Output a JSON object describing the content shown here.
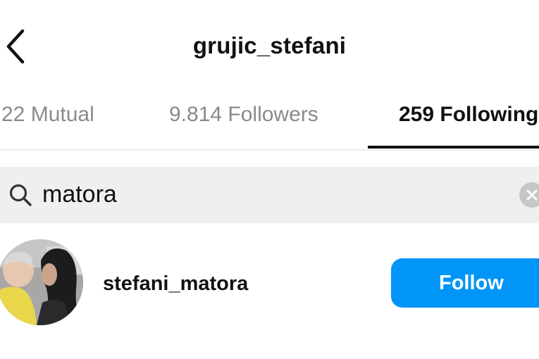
{
  "header": {
    "title": "grujic_stefani",
    "back_icon": "chevron-left-icon"
  },
  "tabs": [
    {
      "label": "22 Mutual",
      "active": false
    },
    {
      "label": "9.814 Followers",
      "active": false
    },
    {
      "label": "259 Following",
      "active": true
    }
  ],
  "search": {
    "value": "matora",
    "icon": "search-icon",
    "clear_icon": "clear-icon"
  },
  "results": [
    {
      "username": "stefani_matora",
      "follow_label": "Follow"
    }
  ],
  "colors": {
    "accent": "#0095f6",
    "muted_text": "#8a8a8a",
    "search_bg": "#efefef"
  }
}
